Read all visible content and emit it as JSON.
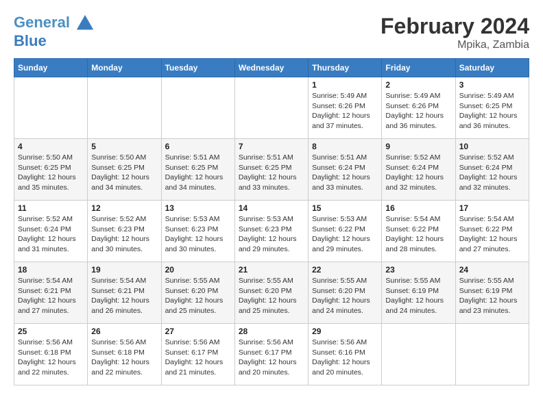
{
  "header": {
    "logo_line1": "General",
    "logo_line2": "Blue",
    "title": "February 2024",
    "subtitle": "Mpika, Zambia"
  },
  "columns": [
    "Sunday",
    "Monday",
    "Tuesday",
    "Wednesday",
    "Thursday",
    "Friday",
    "Saturday"
  ],
  "weeks": [
    [
      {
        "day": "",
        "info": ""
      },
      {
        "day": "",
        "info": ""
      },
      {
        "day": "",
        "info": ""
      },
      {
        "day": "",
        "info": ""
      },
      {
        "day": "1",
        "info": "Sunrise: 5:49 AM\nSunset: 6:26 PM\nDaylight: 12 hours\nand 37 minutes."
      },
      {
        "day": "2",
        "info": "Sunrise: 5:49 AM\nSunset: 6:26 PM\nDaylight: 12 hours\nand 36 minutes."
      },
      {
        "day": "3",
        "info": "Sunrise: 5:49 AM\nSunset: 6:25 PM\nDaylight: 12 hours\nand 36 minutes."
      }
    ],
    [
      {
        "day": "4",
        "info": "Sunrise: 5:50 AM\nSunset: 6:25 PM\nDaylight: 12 hours\nand 35 minutes."
      },
      {
        "day": "5",
        "info": "Sunrise: 5:50 AM\nSunset: 6:25 PM\nDaylight: 12 hours\nand 34 minutes."
      },
      {
        "day": "6",
        "info": "Sunrise: 5:51 AM\nSunset: 6:25 PM\nDaylight: 12 hours\nand 34 minutes."
      },
      {
        "day": "7",
        "info": "Sunrise: 5:51 AM\nSunset: 6:25 PM\nDaylight: 12 hours\nand 33 minutes."
      },
      {
        "day": "8",
        "info": "Sunrise: 5:51 AM\nSunset: 6:24 PM\nDaylight: 12 hours\nand 33 minutes."
      },
      {
        "day": "9",
        "info": "Sunrise: 5:52 AM\nSunset: 6:24 PM\nDaylight: 12 hours\nand 32 minutes."
      },
      {
        "day": "10",
        "info": "Sunrise: 5:52 AM\nSunset: 6:24 PM\nDaylight: 12 hours\nand 32 minutes."
      }
    ],
    [
      {
        "day": "11",
        "info": "Sunrise: 5:52 AM\nSunset: 6:24 PM\nDaylight: 12 hours\nand 31 minutes."
      },
      {
        "day": "12",
        "info": "Sunrise: 5:52 AM\nSunset: 6:23 PM\nDaylight: 12 hours\nand 30 minutes."
      },
      {
        "day": "13",
        "info": "Sunrise: 5:53 AM\nSunset: 6:23 PM\nDaylight: 12 hours\nand 30 minutes."
      },
      {
        "day": "14",
        "info": "Sunrise: 5:53 AM\nSunset: 6:23 PM\nDaylight: 12 hours\nand 29 minutes."
      },
      {
        "day": "15",
        "info": "Sunrise: 5:53 AM\nSunset: 6:22 PM\nDaylight: 12 hours\nand 29 minutes."
      },
      {
        "day": "16",
        "info": "Sunrise: 5:54 AM\nSunset: 6:22 PM\nDaylight: 12 hours\nand 28 minutes."
      },
      {
        "day": "17",
        "info": "Sunrise: 5:54 AM\nSunset: 6:22 PM\nDaylight: 12 hours\nand 27 minutes."
      }
    ],
    [
      {
        "day": "18",
        "info": "Sunrise: 5:54 AM\nSunset: 6:21 PM\nDaylight: 12 hours\nand 27 minutes."
      },
      {
        "day": "19",
        "info": "Sunrise: 5:54 AM\nSunset: 6:21 PM\nDaylight: 12 hours\nand 26 minutes."
      },
      {
        "day": "20",
        "info": "Sunrise: 5:55 AM\nSunset: 6:20 PM\nDaylight: 12 hours\nand 25 minutes."
      },
      {
        "day": "21",
        "info": "Sunrise: 5:55 AM\nSunset: 6:20 PM\nDaylight: 12 hours\nand 25 minutes."
      },
      {
        "day": "22",
        "info": "Sunrise: 5:55 AM\nSunset: 6:20 PM\nDaylight: 12 hours\nand 24 minutes."
      },
      {
        "day": "23",
        "info": "Sunrise: 5:55 AM\nSunset: 6:19 PM\nDaylight: 12 hours\nand 24 minutes."
      },
      {
        "day": "24",
        "info": "Sunrise: 5:55 AM\nSunset: 6:19 PM\nDaylight: 12 hours\nand 23 minutes."
      }
    ],
    [
      {
        "day": "25",
        "info": "Sunrise: 5:56 AM\nSunset: 6:18 PM\nDaylight: 12 hours\nand 22 minutes."
      },
      {
        "day": "26",
        "info": "Sunrise: 5:56 AM\nSunset: 6:18 PM\nDaylight: 12 hours\nand 22 minutes."
      },
      {
        "day": "27",
        "info": "Sunrise: 5:56 AM\nSunset: 6:17 PM\nDaylight: 12 hours\nand 21 minutes."
      },
      {
        "day": "28",
        "info": "Sunrise: 5:56 AM\nSunset: 6:17 PM\nDaylight: 12 hours\nand 20 minutes."
      },
      {
        "day": "29",
        "info": "Sunrise: 5:56 AM\nSunset: 6:16 PM\nDaylight: 12 hours\nand 20 minutes."
      },
      {
        "day": "",
        "info": ""
      },
      {
        "day": "",
        "info": ""
      }
    ]
  ]
}
